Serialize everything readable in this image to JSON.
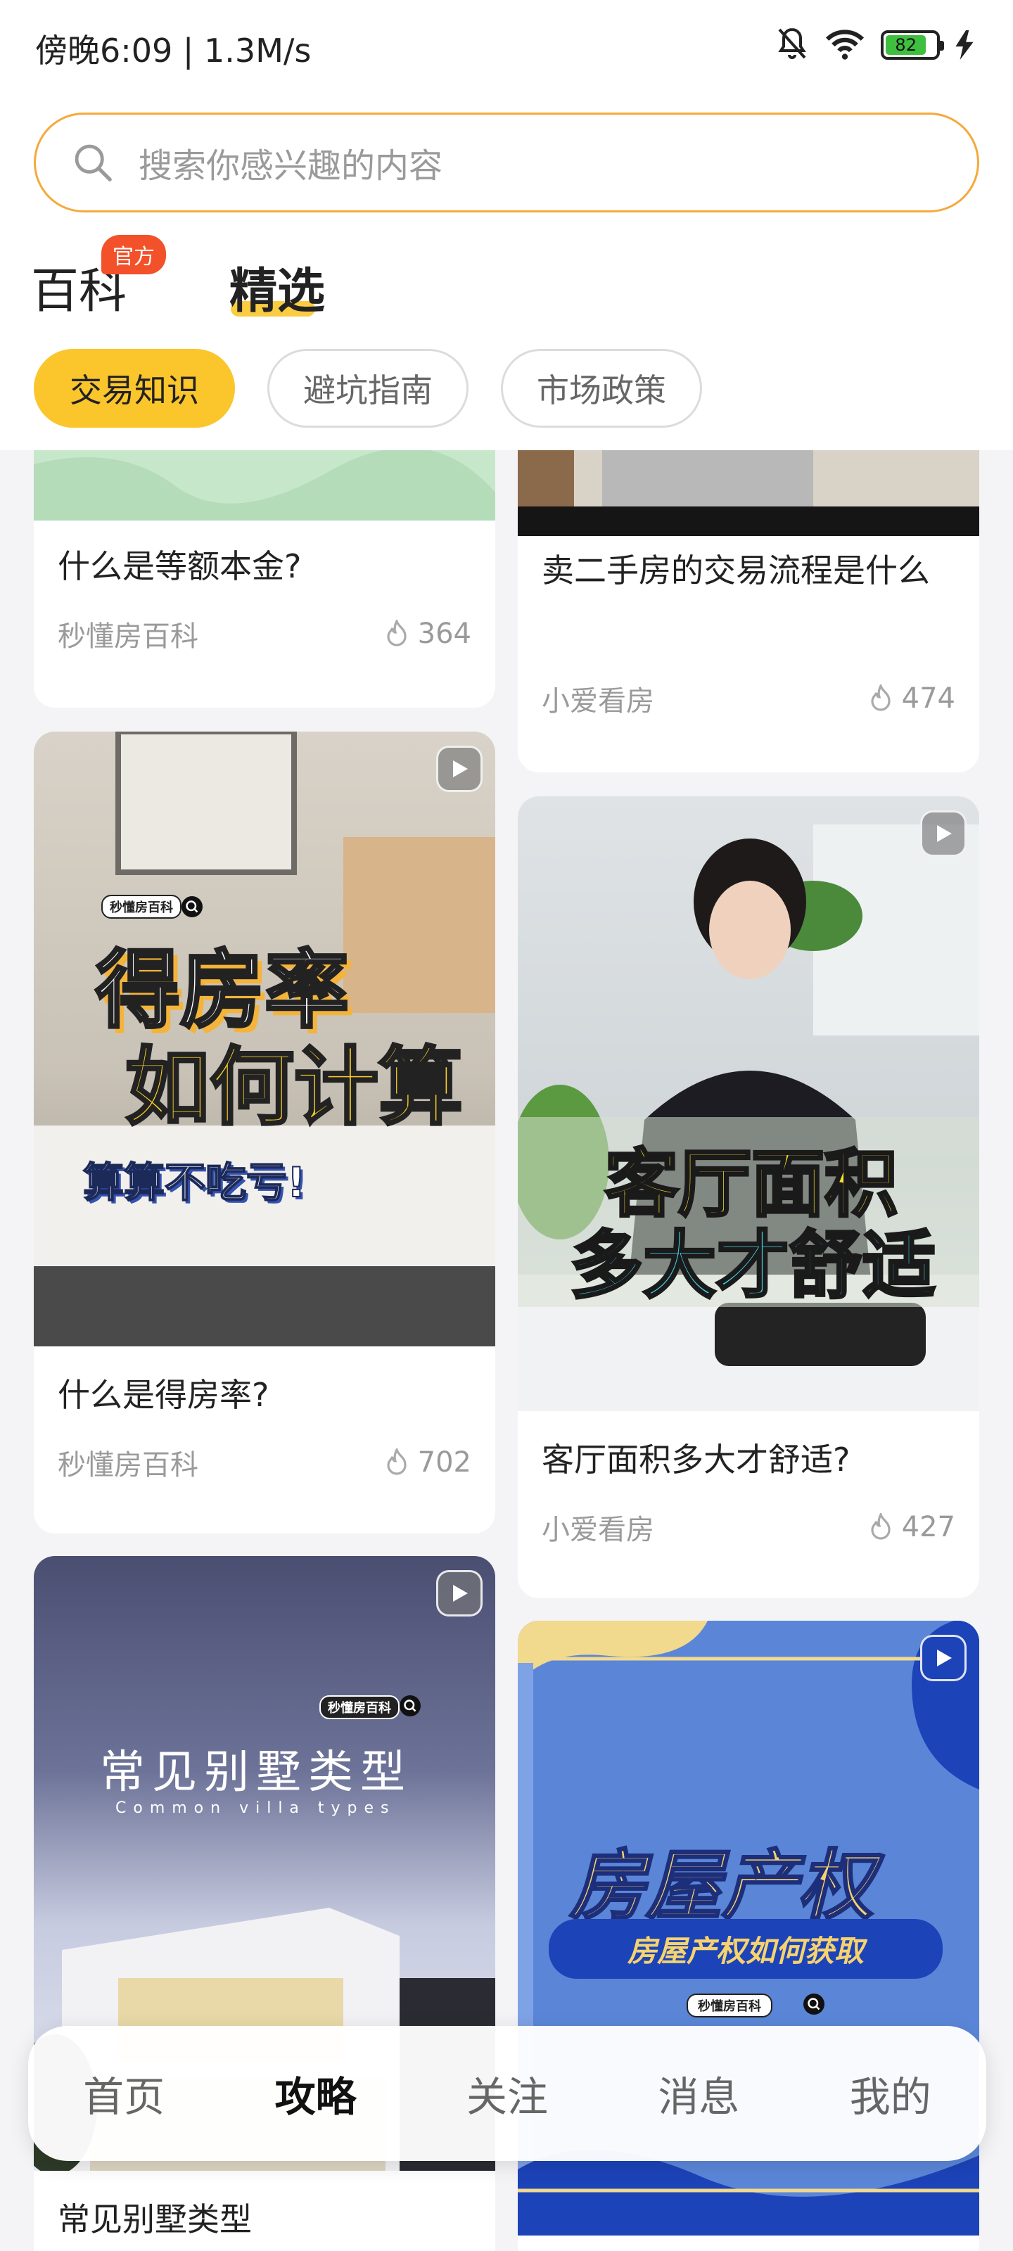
{
  "status": {
    "time": "傍晚6:09 | 1.3M/s",
    "battery": "82",
    "icons": [
      "mute-bell-icon",
      "wifi-icon",
      "battery-icon",
      "charging-icon"
    ]
  },
  "search": {
    "placeholder": "搜索你感兴趣的内容"
  },
  "tabs": {
    "baike": "百科",
    "official_badge": "官方",
    "jingxuan": "精选"
  },
  "chips": [
    "交易知识",
    "避坑指南",
    "市场政策"
  ],
  "cards": [
    {
      "title": "什么是等额本金?",
      "author": "秒懂房百科",
      "likes": "364"
    },
    {
      "title": "卖二手房的交易流程是什么",
      "author": "小爱看房",
      "likes": "474"
    },
    {
      "title": "什么是得房率?",
      "author": "秒懂房百科",
      "likes": "702",
      "cover": {
        "brand": "秒懂房百科",
        "line1": "得房率",
        "line2": "如何计算",
        "line3": "算算不吃亏!"
      }
    },
    {
      "title": "客厅面积多大才舒适?",
      "author": "小爱看房",
      "likes": "427",
      "cover": {
        "line1": "客厅面积",
        "line2": "多大才舒适"
      }
    },
    {
      "title": "常见别墅类型",
      "cover": {
        "brand": "秒懂房百科",
        "line1": "常见别墅类型",
        "line2": "Common villa types"
      }
    },
    {
      "cover": {
        "line1": "房屋产权",
        "line2": "房屋产权如何获取",
        "brand": "秒懂房百科"
      }
    }
  ],
  "bottom_nav": [
    "首页",
    "攻略",
    "关注",
    "消息",
    "我的"
  ],
  "colors": {
    "accent": "#fbc52c",
    "search_border": "#f6a93b",
    "badge": "#f2512a"
  }
}
